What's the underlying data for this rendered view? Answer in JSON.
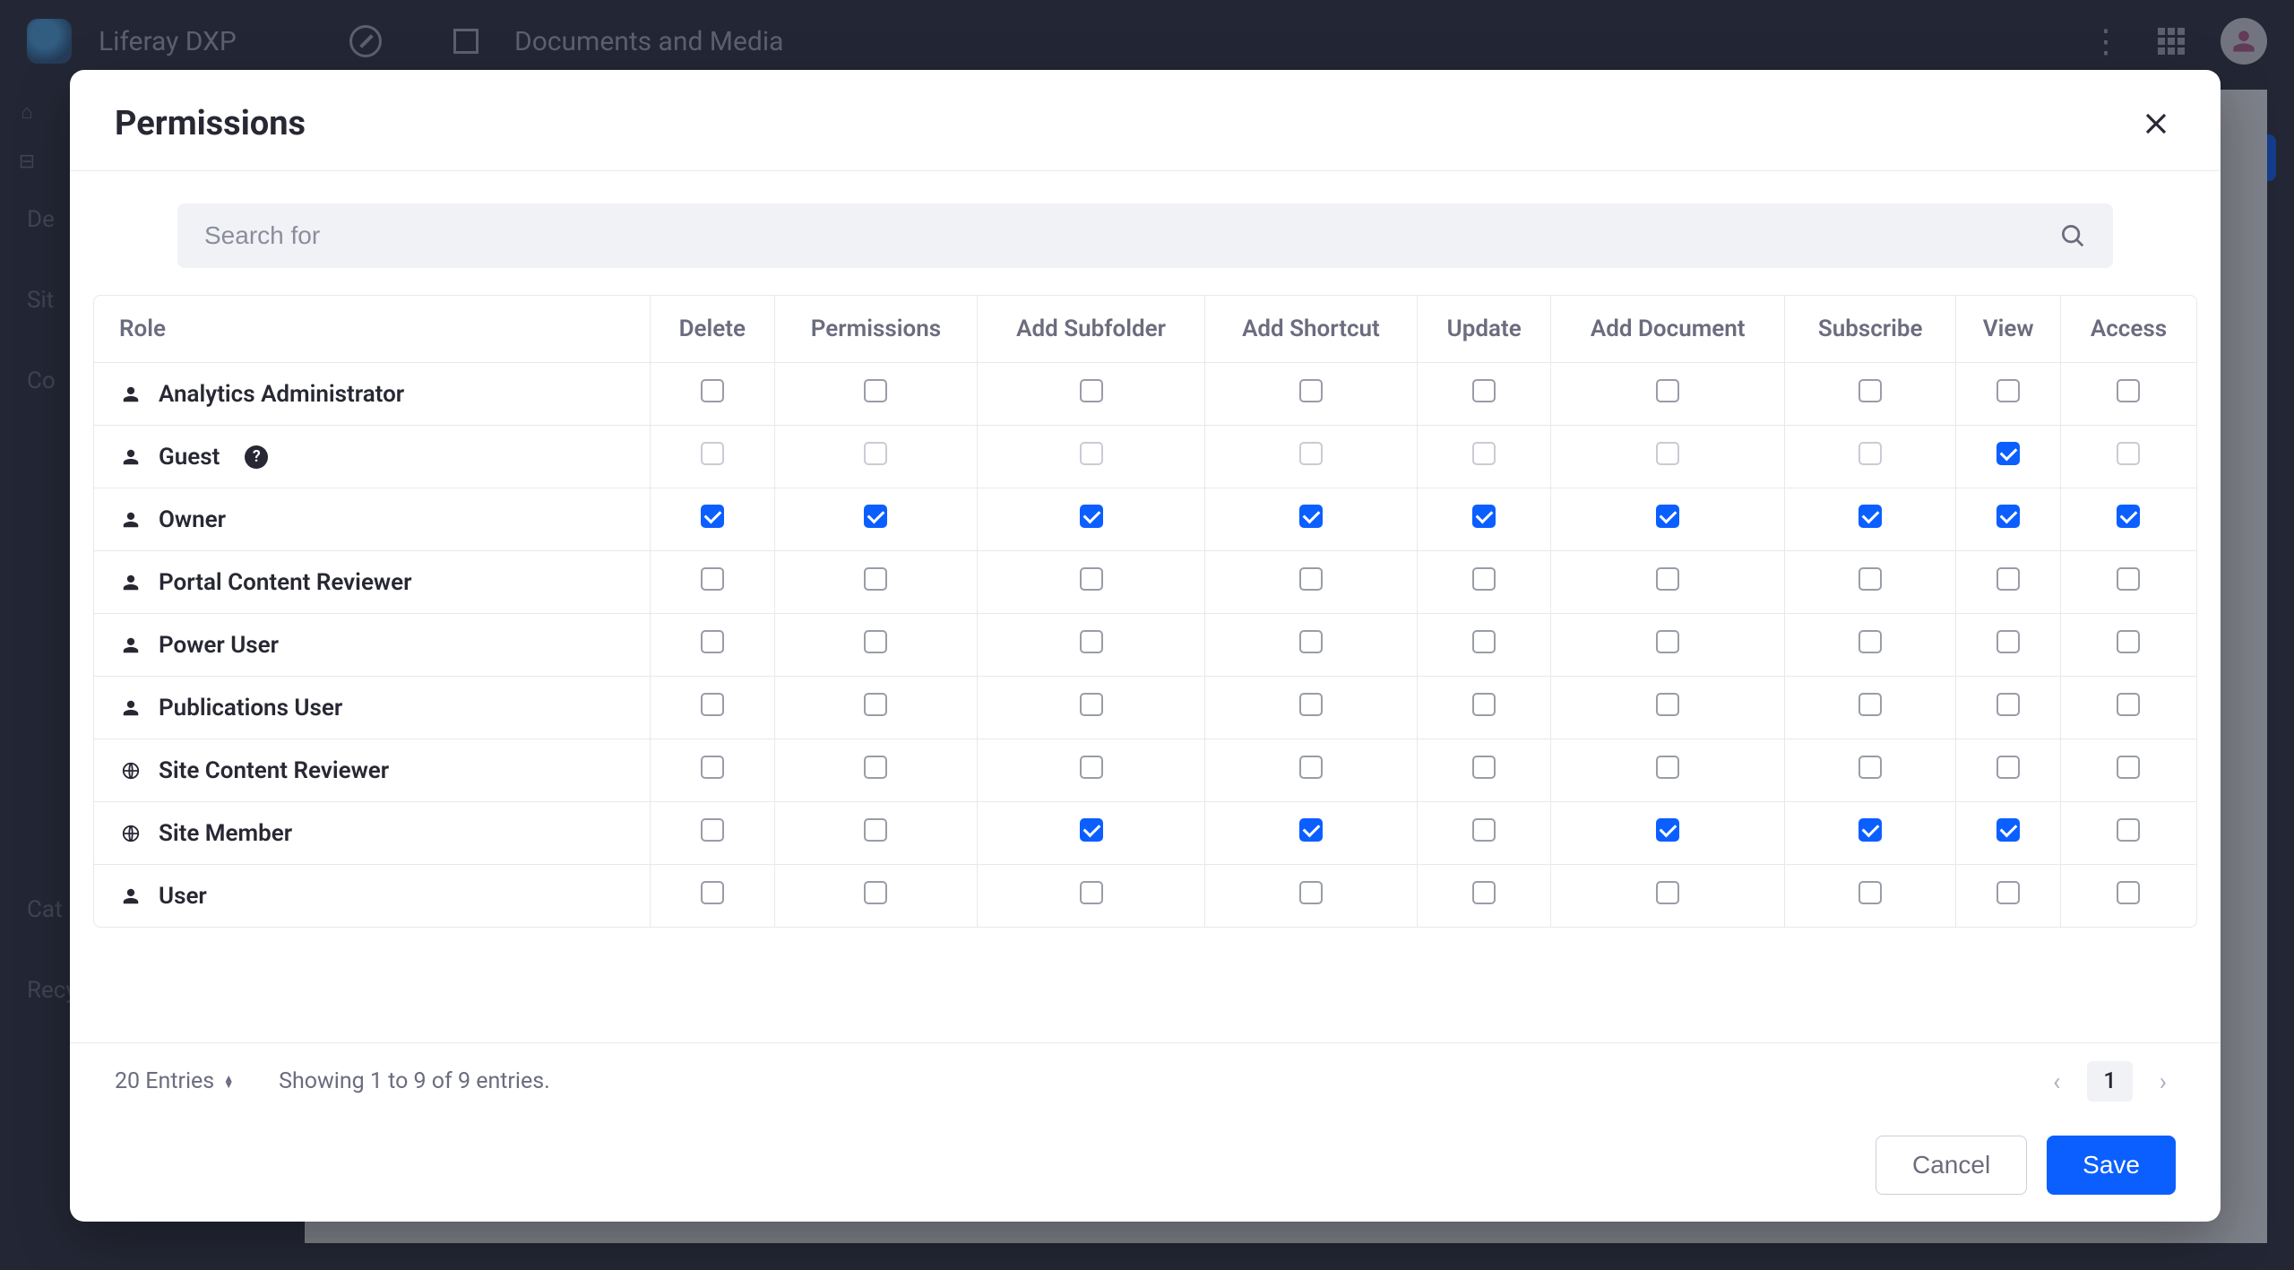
{
  "bg": {
    "product": "Liferay DXP",
    "section": "Documents and Media",
    "sidenav": [
      "De",
      "Sit",
      "Co",
      "Cat",
      "Recycle Bin"
    ]
  },
  "modal": {
    "title": "Permissions",
    "search_placeholder": "Search for",
    "columns": [
      "Role",
      "Delete",
      "Permissions",
      "Add Subfolder",
      "Add Shortcut",
      "Update",
      "Add Document",
      "Subscribe",
      "View",
      "Access"
    ],
    "roles": [
      {
        "name": "Analytics Administrator",
        "icon": "user",
        "help": false,
        "perms": [
          false,
          false,
          false,
          false,
          false,
          false,
          false,
          false,
          false
        ]
      },
      {
        "name": "Guest",
        "icon": "user",
        "help": true,
        "disabled": true,
        "perms": [
          false,
          false,
          false,
          false,
          false,
          false,
          false,
          true,
          false
        ]
      },
      {
        "name": "Owner",
        "icon": "user",
        "help": false,
        "perms": [
          true,
          true,
          true,
          true,
          true,
          true,
          true,
          true,
          true
        ]
      },
      {
        "name": "Portal Content Reviewer",
        "icon": "user",
        "help": false,
        "perms": [
          false,
          false,
          false,
          false,
          false,
          false,
          false,
          false,
          false
        ]
      },
      {
        "name": "Power User",
        "icon": "user",
        "help": false,
        "perms": [
          false,
          false,
          false,
          false,
          false,
          false,
          false,
          false,
          false
        ]
      },
      {
        "name": "Publications User",
        "icon": "user",
        "help": false,
        "perms": [
          false,
          false,
          false,
          false,
          false,
          false,
          false,
          false,
          false
        ]
      },
      {
        "name": "Site Content Reviewer",
        "icon": "globe",
        "help": false,
        "perms": [
          false,
          false,
          false,
          false,
          false,
          false,
          false,
          false,
          false
        ]
      },
      {
        "name": "Site Member",
        "icon": "globe",
        "help": false,
        "perms": [
          false,
          false,
          true,
          true,
          false,
          true,
          true,
          true,
          false
        ]
      },
      {
        "name": "User",
        "icon": "user",
        "help": false,
        "perms": [
          false,
          false,
          false,
          false,
          false,
          false,
          false,
          false,
          false
        ]
      }
    ],
    "entries_label": "20 Entries",
    "showing": "Showing 1 to 9 of 9 entries.",
    "page": "1",
    "cancel": "Cancel",
    "save": "Save"
  }
}
